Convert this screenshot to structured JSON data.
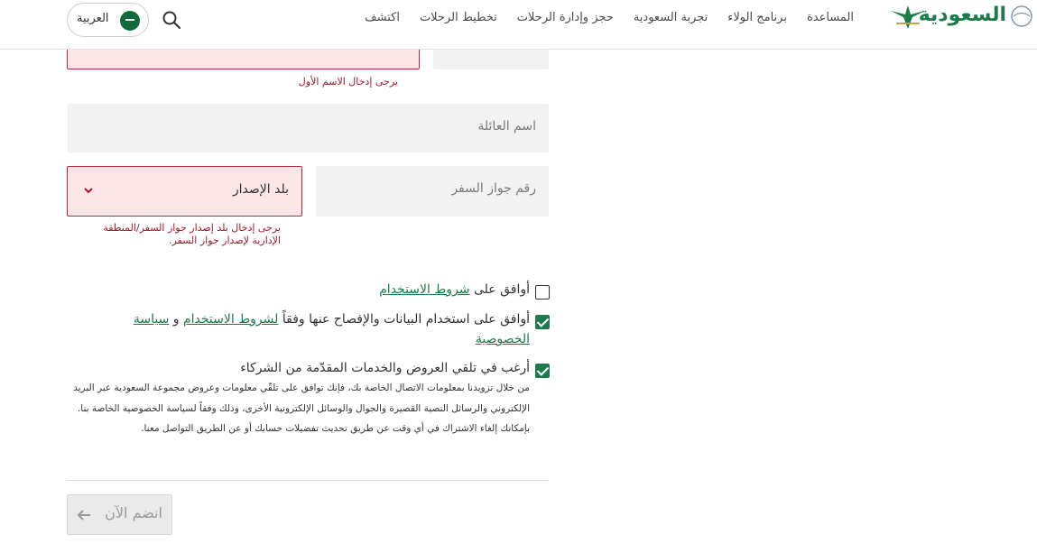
{
  "header": {
    "brand": "السعودية",
    "nav": [
      "اكتشف",
      "تخطيط الرحلات",
      "حجز وإدارة الرحلات",
      "تجربة السعودية",
      "برنامج الولاء",
      "المساعدة"
    ],
    "language": "العربية"
  },
  "form": {
    "first_name_error": "يرجى إدخال الاسم الأول",
    "last_name_placeholder": "اسم العائلة",
    "passport_placeholder": "رقم جواز السفر",
    "country_value": "بلد الإصدار",
    "country_error_line1": "يرجى إدخال بلد إصدار جواز السفر/المنطقة",
    "country_error_line2": "الإدارية لإصدار جواز السفر."
  },
  "consents": {
    "terms": {
      "prefix": "أوافق على ",
      "link": "شروط الاستخدام",
      "checked": false
    },
    "data_use": {
      "prefix": "أوافق على استخدام البيانات والإفصاح عنها وفقاً ",
      "link1": "لشروط الاستخدام",
      "mid": " و ",
      "link2": "سياسة الخصوصية",
      "checked": true
    },
    "offers": {
      "label": "أرغب في تلقي العروض والخدمات المقدّمة من الشركاء",
      "checked": true
    },
    "fine_print": "من خلال تزويدنا بمعلومات الاتصال الخاصة بك، فإنك توافق على تلقّي معلومات وعروض مجموعة السعودية عبر البريد الإلكتروني والرسائل النصية القصيرة والجوال والوسائل الإلكترونية الأخرى، وذلك وفقاً لسياسة الخصوصية الخاصة بنا. بإمكانك إلغاء الاشتراك في أي وقت عن طريق تحديث تفضيلات حسابك أو عن الطريق التواصل معنا."
  },
  "submit": {
    "label": "انضم الآن"
  },
  "colors": {
    "brand_green": "#1d7a4a",
    "error_red": "#a3162b",
    "error_bg": "#fce6e8"
  }
}
